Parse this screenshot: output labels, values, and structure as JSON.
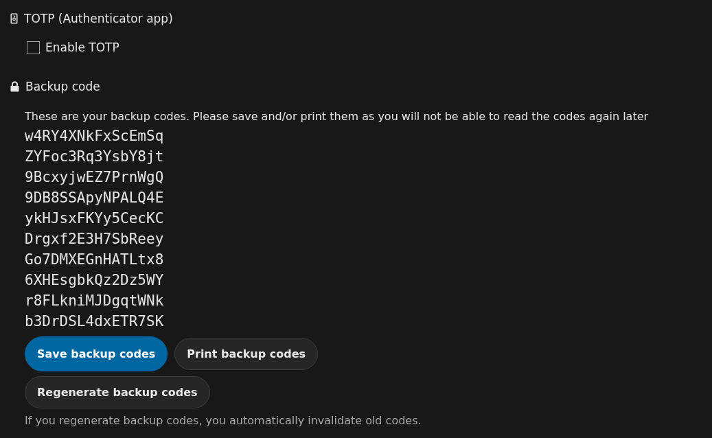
{
  "totp": {
    "heading": "TOTP (Authenticator app)",
    "enable": {
      "label": "Enable TOTP",
      "checked": false
    }
  },
  "backup": {
    "heading": "Backup code",
    "intro": "These are your backup codes. Please save and/or print them as you will not be able to read the codes again later",
    "codes": [
      "w4RY4XNkFxScEmSq",
      "ZYFoc3Rq3YsbY8jt",
      "9BcxyjwEZ7PrnWgQ",
      "9DB8SSApyNPALQ4E",
      "ykHJsxFKYy5CecKC",
      "Drgxf2E3H7SbReey",
      "Go7DMXEGnHATLtx8",
      "6XHEsgbkQz2Dz5WY",
      "r8FLkniMJDgqtWNk",
      "b3DrDSL4dxETR7SK"
    ],
    "button_rows": [
      [
        {
          "label": "Save backup codes",
          "kind": "primary"
        },
        {
          "label": "Print backup codes",
          "kind": "secondary"
        }
      ],
      [
        {
          "label": "Regenerate backup codes",
          "kind": "secondary"
        }
      ]
    ],
    "hint": "If you regenerate backup codes, you automatically invalidate old codes."
  }
}
